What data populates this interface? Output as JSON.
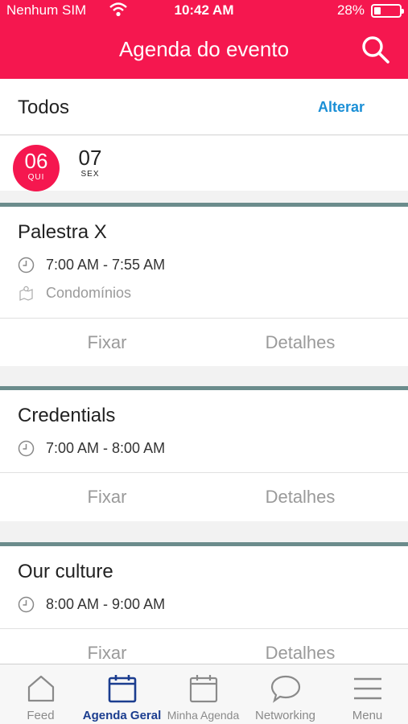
{
  "status_bar": {
    "carrier": "Nenhum SIM",
    "time": "10:42 AM",
    "battery": "28%",
    "battery_level": 0.28
  },
  "header": {
    "title": "Agenda do evento",
    "search_icon": "search-icon",
    "color": "#f5174f"
  },
  "filter": {
    "label": "Todos",
    "change": "Alterar",
    "link_color": "#1a8fd6"
  },
  "days": [
    {
      "num": "06",
      "weekday": "QUI",
      "selected": true
    },
    {
      "num": "07",
      "weekday": "SEX",
      "selected": false
    }
  ],
  "sessions": [
    {
      "title": "Palestra X",
      "time": "7:00 AM - 7:55 AM",
      "location": "Condomínios",
      "pin": "Fixar",
      "details": "Detalhes"
    },
    {
      "title": "Credentials",
      "time": "7:00 AM - 8:00 AM",
      "pin": "Fixar",
      "details": "Detalhes"
    },
    {
      "title": "Our culture",
      "time": "8:00 AM - 9:00 AM",
      "pin": "Fixar",
      "details": "Detalhes"
    }
  ],
  "tabs": [
    {
      "label": "Feed",
      "icon": "home-icon",
      "active": false
    },
    {
      "label": "Agenda Geral",
      "icon": "calendar-icon",
      "active": true
    },
    {
      "label": "Minha Agenda",
      "icon": "calendar-icon",
      "active": false
    },
    {
      "label": "Networking",
      "icon": "chat-bubble-icon",
      "active": false
    },
    {
      "label": "Menu",
      "icon": "hamburger-menu-icon",
      "active": false
    }
  ]
}
